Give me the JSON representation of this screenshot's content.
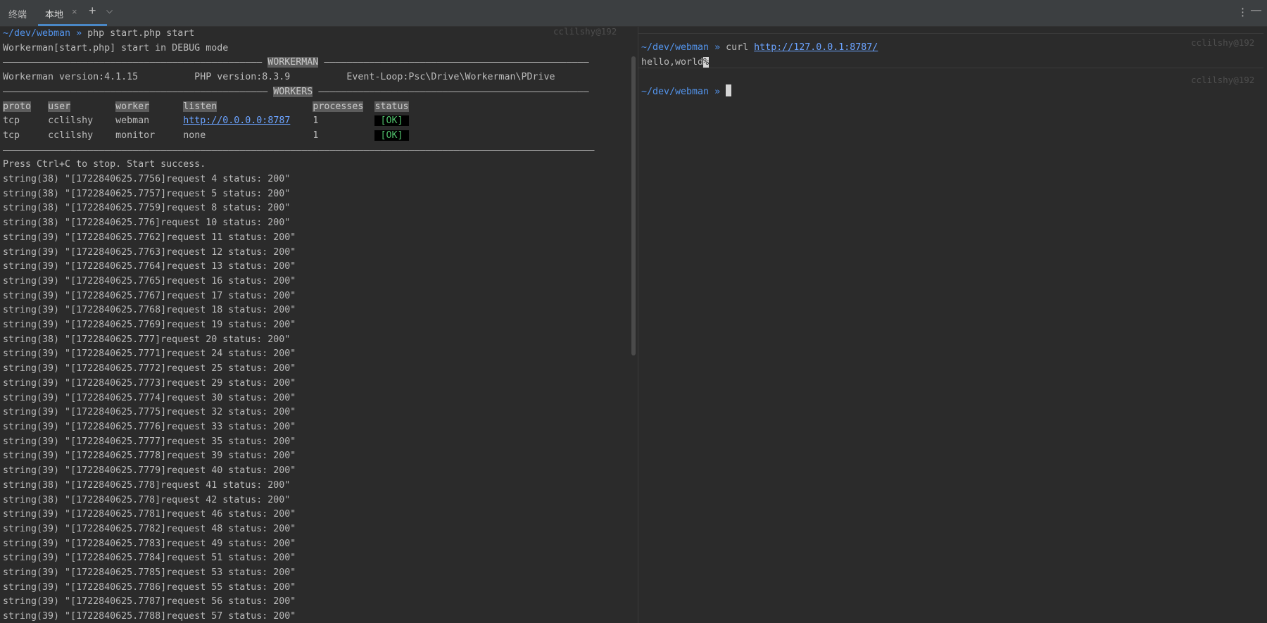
{
  "tabbar": {
    "title": "终端",
    "tab_label": "本地",
    "close_glyph": "×",
    "new_tab_glyph": "+",
    "dropdown_glyph": "⌵",
    "more_glyph": "⋮",
    "minimize_glyph": "—"
  },
  "left": {
    "prompt_path": "~/dev/webman",
    "prompt_symbol": "»",
    "command": "php start.php start",
    "right_info": "cclilshy@192",
    "mode_line": "Workerman[start.php] start in DEBUG mode",
    "banner_workerman": "WORKERMAN",
    "banner_workers": "WORKERS",
    "version_line": "Workerman version:4.1.15          PHP version:8.3.9          Event-Loop:Psc\\Drive\\Workerman\\PDrive",
    "columns": [
      "proto",
      "user",
      "worker",
      "listen",
      "processes",
      "status"
    ],
    "workers": [
      {
        "proto": "tcp",
        "user": "cclilshy",
        "worker": "webman",
        "listen": "http://0.0.0.0:8787",
        "processes": "1",
        "status": "[OK]"
      },
      {
        "proto": "tcp",
        "user": "cclilshy",
        "worker": "monitor",
        "listen": "none",
        "processes": "1",
        "status": "[OK]"
      }
    ],
    "success_line": "Press Ctrl+C to stop. Start success.",
    "log_lines": [
      "string(38) \"[1722840625.7756]request 4 status: 200\"",
      "string(38) \"[1722840625.7757]request 5 status: 200\"",
      "string(38) \"[1722840625.7759]request 8 status: 200\"",
      "string(38) \"[1722840625.776]request 10 status: 200\"",
      "string(39) \"[1722840625.7762]request 11 status: 200\"",
      "string(39) \"[1722840625.7763]request 12 status: 200\"",
      "string(39) \"[1722840625.7764]request 13 status: 200\"",
      "string(39) \"[1722840625.7765]request 16 status: 200\"",
      "string(39) \"[1722840625.7767]request 17 status: 200\"",
      "string(39) \"[1722840625.7768]request 18 status: 200\"",
      "string(39) \"[1722840625.7769]request 19 status: 200\"",
      "string(38) \"[1722840625.777]request 20 status: 200\"",
      "string(39) \"[1722840625.7771]request 24 status: 200\"",
      "string(39) \"[1722840625.7772]request 25 status: 200\"",
      "string(39) \"[1722840625.7773]request 29 status: 200\"",
      "string(39) \"[1722840625.7774]request 30 status: 200\"",
      "string(39) \"[1722840625.7775]request 32 status: 200\"",
      "string(39) \"[1722840625.7776]request 33 status: 200\"",
      "string(39) \"[1722840625.7777]request 35 status: 200\"",
      "string(39) \"[1722840625.7778]request 39 status: 200\"",
      "string(39) \"[1722840625.7779]request 40 status: 200\"",
      "string(38) \"[1722840625.778]request 41 status: 200\"",
      "string(38) \"[1722840625.778]request 42 status: 200\"",
      "string(39) \"[1722840625.7781]request 46 status: 200\"",
      "string(39) \"[1722840625.7782]request 48 status: 200\"",
      "string(39) \"[1722840625.7783]request 49 status: 200\"",
      "string(39) \"[1722840625.7784]request 51 status: 200\"",
      "string(39) \"[1722840625.7785]request 53 status: 200\"",
      "string(39) \"[1722840625.7786]request 55 status: 200\"",
      "string(39) \"[1722840625.7787]request 56 status: 200\"",
      "string(39) \"[1722840625.7788]request 57 status: 200\""
    ]
  },
  "right": {
    "prompt_path": "~/dev/webman",
    "prompt_symbol": "»",
    "command": "curl",
    "url": "http://127.0.0.1:8787/",
    "output": "hello,world",
    "output_end_marker": "%",
    "right_info": "cclilshy@192"
  },
  "colors": {
    "background": "#2b2b2b",
    "tabbar": "#3c3f41",
    "prompt": "#5394ec",
    "link": "#6ba3ff",
    "ok": "#4fbe6a",
    "accent": "#4a88c7"
  }
}
